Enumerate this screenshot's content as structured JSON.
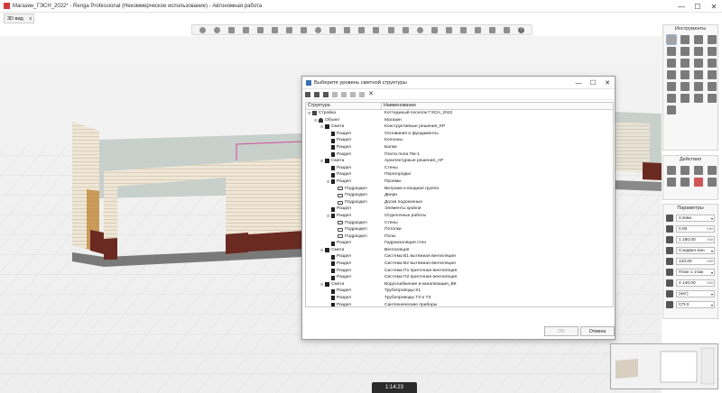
{
  "window": {
    "title": "Магазин_ГЭСН_2022* - Renga Professional (Некоммерческое использование) - Автономная работа",
    "minimize": "—",
    "maximize": "☐",
    "close": "✕"
  },
  "view_tab": {
    "label": "3D вид",
    "close": "x"
  },
  "dialog": {
    "title": "Выберите уровень сметной структуры",
    "columns": [
      "Структура",
      "Наименование"
    ],
    "rows": [
      {
        "level": 0,
        "expander": "⊟",
        "icon": "build",
        "type": "Стройка",
        "name": "Коттеджный поселок ГЭСН_2022"
      },
      {
        "level": 1,
        "expander": "⊟",
        "icon": "obj",
        "type": "Объект",
        "name": "Магазин"
      },
      {
        "level": 2,
        "expander": "⊟",
        "icon": "smeta",
        "type": "Смета",
        "name": "Конструктивные решения_КР"
      },
      {
        "level": 3,
        "expander": "",
        "icon": "razdel",
        "type": "Раздел",
        "name": "Основания и фундаменты"
      },
      {
        "level": 3,
        "expander": "",
        "icon": "razdel",
        "type": "Раздел",
        "name": "Колонны"
      },
      {
        "level": 3,
        "expander": "",
        "icon": "razdel",
        "type": "Раздел",
        "name": "Балки"
      },
      {
        "level": 3,
        "expander": "",
        "icon": "razdel",
        "type": "Раздел",
        "name": "Плита пола Пм-1"
      },
      {
        "level": 2,
        "expander": "⊟",
        "icon": "smeta",
        "type": "Смета",
        "name": "Архитектурные решения_АР"
      },
      {
        "level": 3,
        "expander": "",
        "icon": "razdel",
        "type": "Раздел",
        "name": "Стены"
      },
      {
        "level": 3,
        "expander": "",
        "icon": "razdel",
        "type": "Раздел",
        "name": "Перегородки"
      },
      {
        "level": 3,
        "expander": "⊟",
        "icon": "razdel",
        "type": "Раздел",
        "name": "Проемы"
      },
      {
        "level": 4,
        "expander": "",
        "icon": "pod",
        "type": "Подраздел",
        "name": "Витражи и входная группа"
      },
      {
        "level": 4,
        "expander": "",
        "icon": "pod",
        "type": "Подраздел",
        "name": "Двери"
      },
      {
        "level": 4,
        "expander": "",
        "icon": "pod",
        "type": "Подраздел",
        "name": "Доски подоконные"
      },
      {
        "level": 3,
        "expander": "",
        "icon": "razdel",
        "type": "Раздел",
        "name": "Элементы кровли"
      },
      {
        "level": 3,
        "expander": "⊟",
        "icon": "razdel",
        "type": "Раздел",
        "name": "Отделочные работы"
      },
      {
        "level": 4,
        "expander": "",
        "icon": "pod",
        "type": "Подраздел",
        "name": "Стены"
      },
      {
        "level": 4,
        "expander": "",
        "icon": "pod",
        "type": "Подраздел",
        "name": "Потолки"
      },
      {
        "level": 4,
        "expander": "",
        "icon": "pod",
        "type": "Подраздел",
        "name": "Полы"
      },
      {
        "level": 3,
        "expander": "",
        "icon": "razdel",
        "type": "Раздел",
        "name": "Гидроизоляция стен"
      },
      {
        "level": 2,
        "expander": "⊟",
        "icon": "smeta",
        "type": "Смета",
        "name": "Вентиляция"
      },
      {
        "level": 3,
        "expander": "",
        "icon": "razdel",
        "type": "Раздел",
        "name": "Система В1 вытяжная вентиляция"
      },
      {
        "level": 3,
        "expander": "",
        "icon": "razdel",
        "type": "Раздел",
        "name": "Система В2 вытяжная вентиляция"
      },
      {
        "level": 3,
        "expander": "",
        "icon": "razdel",
        "type": "Раздел",
        "name": "Система П1 приточная вентиляция"
      },
      {
        "level": 3,
        "expander": "",
        "icon": "razdel",
        "type": "Раздел",
        "name": "Система П2 приточная вентиляция"
      },
      {
        "level": 2,
        "expander": "⊟",
        "icon": "smeta",
        "type": "Смета",
        "name": "Водоснабжение и канализация_ВК"
      },
      {
        "level": 3,
        "expander": "",
        "icon": "razdel",
        "type": "Раздел",
        "name": "Трубопроводы К1"
      },
      {
        "level": 3,
        "expander": "",
        "icon": "razdel",
        "type": "Раздел",
        "name": "Трубопроводы Т3 и Т3"
      },
      {
        "level": 3,
        "expander": "",
        "icon": "razdel",
        "type": "Раздел",
        "name": "Сантехнические приборы"
      }
    ],
    "ok_label": "OK",
    "cancel_label": "Отмена"
  },
  "panels": {
    "tools_title": "Инструменты",
    "actions_title": "Действия",
    "params_title": "Параметры",
    "params": [
      {
        "icon": "align-icon",
        "value": "Слева",
        "kind": "select"
      },
      {
        "icon": "offset-icon",
        "value": "0,00",
        "unit": "мм"
      },
      {
        "icon": "height-icon",
        "value": "1 180,00",
        "unit": "мм"
      },
      {
        "icon": "material-icon",
        "value": "Сэндвич-пан",
        "kind": "select"
      },
      {
        "icon": "thickness-icon",
        "value": "120,00",
        "unit": "мм"
      },
      {
        "icon": "level-icon",
        "value": "План 1 этаж",
        "kind": "select"
      },
      {
        "icon": "elevation-icon",
        "value": "4 140,00",
        "unit": "мм"
      },
      {
        "icon": "hatch-icon",
        "value": "(нет)",
        "kind": "select"
      },
      {
        "icon": "style-icon",
        "value": "СП-3",
        "kind": "select"
      }
    ]
  },
  "timer": "1:14:23"
}
